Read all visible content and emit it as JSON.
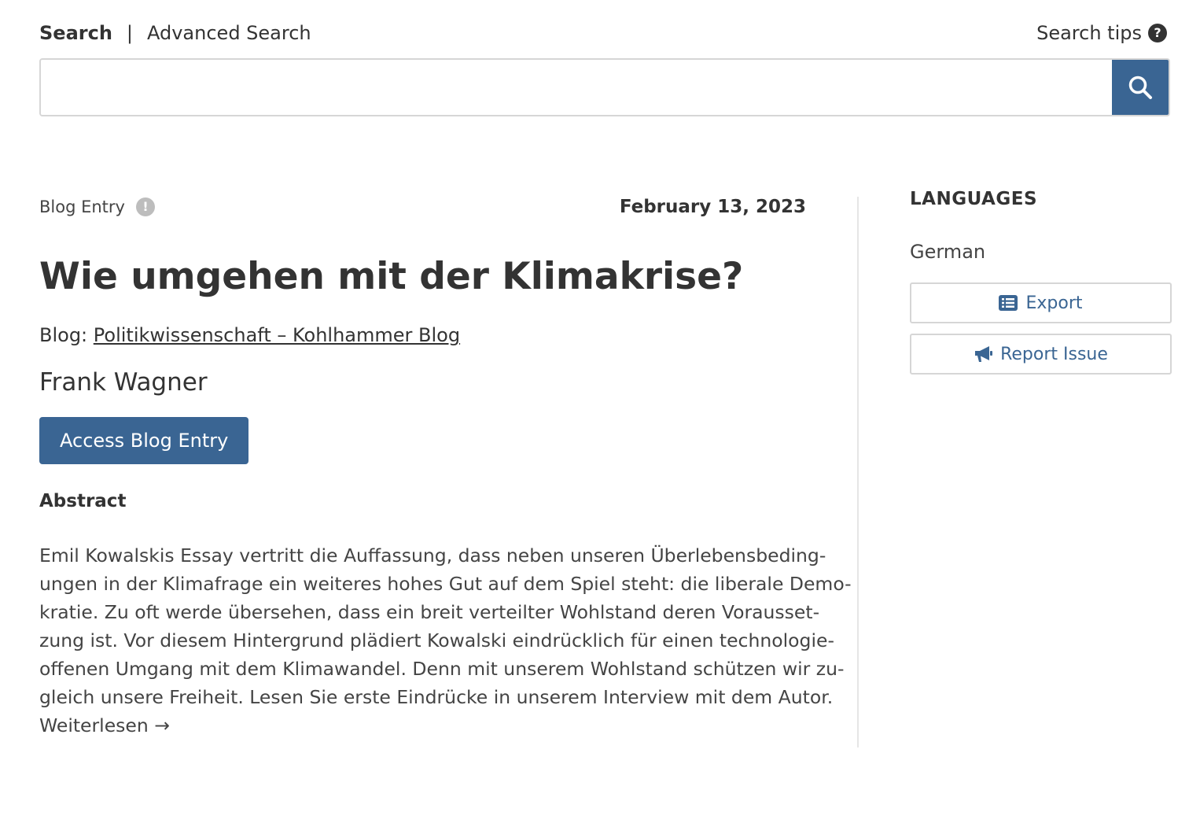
{
  "search": {
    "tab_search": "Search",
    "separator": "|",
    "tab_advanced": "Advanced Search",
    "tips_label": "Search tips",
    "tips_icon": "?",
    "input_value": "",
    "input_placeholder": ""
  },
  "entry": {
    "type_label": "Blog Entry",
    "info_icon": "!",
    "date": "February 13, 2023",
    "title": "Wie umgehen mit der Klimakrise?",
    "blog_prefix": "Blog:",
    "blog_name": "Politikwissenschaft – Kohlhammer Blog",
    "author": "Frank Wagner",
    "access_button": "Access Blog Entry",
    "abstract_heading": "Abstract",
    "abstract_lines": [
      "Emil Kowalskis Essay vertritt die Auffassung, dass neben unseren Überlebensbeding-",
      "ungen in der Klimafrage ein weiteres hohes Gut auf dem Spiel steht: die liberale Demo-",
      "kratie. Zu oft werde übersehen, dass ein breit verteilter Wohlstand deren Vorausset-",
      "zung ist. Vor diesem Hintergrund plädiert Kowalski eindrücklich für einen technologie-",
      "offenen Umgang mit dem Klimawandel. Denn mit unserem Wohlstand schützen wir zu-",
      "gleich unsere Freiheit. Lesen Sie erste Eindrücke in unserem Interview mit dem Autor.",
      "Weiterlesen →"
    ]
  },
  "sidebar": {
    "languages_heading": "LANGUAGES",
    "language": "German",
    "export_label": "Export",
    "report_label": "Report Issue"
  },
  "colors": {
    "accent": "#3a6593",
    "text": "#333333",
    "border": "#d6d6d6"
  },
  "icons": {
    "search_button": "search-icon",
    "export": "list-icon",
    "report": "megaphone-icon"
  }
}
